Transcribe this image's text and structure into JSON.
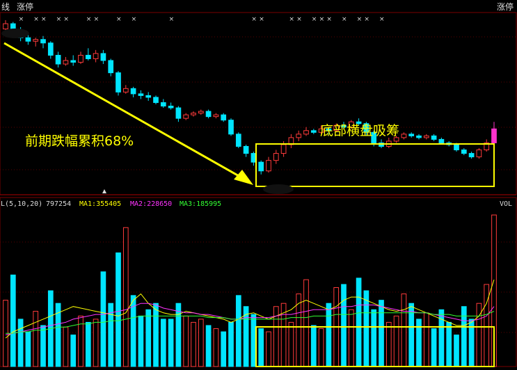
{
  "header": {
    "left_label_1": "线",
    "left_label_2": "涨停",
    "right_label": "涨停",
    "limit_marker": "×"
  },
  "colors": {
    "up": "#ff3b3b",
    "down": "#00e5ff",
    "flat": "#dddddd",
    "ma1": "#ffff00",
    "ma2": "#ff33ff",
    "ma3": "#33ff33",
    "annotation": "#ffff00",
    "grid": "#7a0000",
    "last_bar": "#ff33cc"
  },
  "annotations": {
    "decline_text": "前期跌幅累积68%",
    "bottom_text": "底部横盘吸筹"
  },
  "volume_header": {
    "prefix": "L(5,10,20)",
    "vol_value": "797254",
    "ma1_label": "MA1:355405",
    "ma2_label": "MA2:228650",
    "ma3_label": "MA3:185995",
    "vol_label": "VOL"
  },
  "chart_data": {
    "type": "candlestick",
    "price_panel": {
      "ylim": [
        0,
        100
      ]
    },
    "volume_panel": {
      "ylim": [
        0,
        100
      ]
    },
    "limit_up_bar_indices": [
      2,
      4,
      5,
      7,
      8,
      11,
      12,
      15,
      17,
      22,
      33,
      34,
      38,
      39,
      41,
      42,
      43,
      45,
      47,
      48,
      50
    ],
    "candles": [
      [
        93,
        96,
        98,
        90
      ],
      [
        96,
        91,
        97,
        88
      ],
      [
        91,
        88,
        94,
        86
      ],
      [
        88,
        86,
        90,
        84
      ],
      [
        86,
        87,
        88,
        83
      ],
      [
        87,
        85,
        89,
        82
      ],
      [
        85,
        78,
        86,
        76
      ],
      [
        78,
        73,
        80,
        71
      ],
      [
        73,
        75,
        77,
        72
      ],
      [
        75,
        74,
        78,
        72
      ],
      [
        74,
        78,
        80,
        73
      ],
      [
        78,
        76,
        82,
        75
      ],
      [
        76,
        79,
        81,
        74
      ],
      [
        79,
        75,
        81,
        73
      ],
      [
        75,
        68,
        76,
        66
      ],
      [
        68,
        57,
        69,
        55
      ],
      [
        57,
        59,
        61,
        56
      ],
      [
        59,
        56,
        60,
        54
      ],
      [
        56,
        55,
        58,
        53
      ],
      [
        55,
        54,
        57,
        52
      ],
      [
        54,
        51,
        55,
        50
      ],
      [
        51,
        49,
        53,
        48
      ],
      [
        49,
        48,
        51,
        47
      ],
      [
        48,
        42,
        49,
        40
      ],
      [
        42,
        44,
        45,
        41
      ],
      [
        44,
        45,
        46,
        43
      ],
      [
        45,
        46,
        47,
        44
      ],
      [
        46,
        43,
        47,
        42
      ],
      [
        43,
        44,
        45,
        42
      ],
      [
        44,
        41,
        45,
        40
      ],
      [
        41,
        33,
        42,
        32
      ],
      [
        33,
        26,
        34,
        25
      ],
      [
        26,
        22,
        27,
        20
      ],
      [
        22,
        17,
        23,
        15
      ],
      [
        17,
        12,
        18,
        10
      ],
      [
        12,
        18,
        20,
        11
      ],
      [
        18,
        22,
        24,
        16
      ],
      [
        22,
        27,
        29,
        20
      ],
      [
        27,
        31,
        33,
        25
      ],
      [
        31,
        33,
        35,
        29
      ],
      [
        33,
        35,
        37,
        32
      ],
      [
        35,
        34,
        36,
        33
      ],
      [
        34,
        36,
        38,
        33
      ],
      [
        36,
        35,
        37,
        33
      ],
      [
        35,
        38,
        39,
        34
      ],
      [
        38,
        37,
        40,
        36
      ],
      [
        37,
        40,
        41,
        36
      ],
      [
        40,
        39,
        42,
        38
      ],
      [
        39,
        34,
        40,
        32
      ],
      [
        34,
        28,
        35,
        26
      ],
      [
        28,
        26,
        30,
        25
      ],
      [
        26,
        29,
        31,
        25
      ],
      [
        29,
        31,
        32,
        28
      ],
      [
        31,
        33,
        34,
        30
      ],
      [
        33,
        32,
        34,
        31
      ],
      [
        32,
        31,
        33,
        30
      ],
      [
        31,
        32,
        33,
        30
      ],
      [
        32,
        30,
        33,
        29
      ],
      [
        30,
        28,
        31,
        27
      ],
      [
        28,
        27,
        29,
        26
      ],
      [
        27,
        24,
        28,
        23
      ],
      [
        24,
        22,
        25,
        21
      ],
      [
        22,
        20,
        23,
        19
      ],
      [
        20,
        24,
        25,
        19
      ],
      [
        24,
        28,
        30,
        23
      ],
      [
        28,
        36,
        40,
        27
      ]
    ],
    "volume": [
      42,
      58,
      30,
      22,
      35,
      26,
      48,
      40,
      25,
      20,
      32,
      28,
      30,
      60,
      40,
      72,
      88,
      45,
      32,
      36,
      40,
      30,
      30,
      40,
      32,
      28,
      30,
      26,
      24,
      22,
      28,
      45,
      38,
      33,
      24,
      22,
      38,
      40,
      28,
      46,
      55,
      26,
      24,
      40,
      50,
      52,
      36,
      56,
      48,
      36,
      42,
      28,
      32,
      46,
      40,
      30,
      34,
      24,
      36,
      28,
      20,
      38,
      30,
      40,
      52,
      96
    ],
    "ma1": [
      18,
      22,
      24,
      26,
      28,
      30,
      32,
      34,
      36,
      38,
      37,
      36,
      35,
      34,
      33,
      32,
      34,
      42,
      46,
      40,
      36,
      34,
      33,
      33,
      35,
      34,
      33,
      32,
      31,
      30,
      28,
      30,
      33,
      34,
      32,
      30,
      32,
      34,
      36,
      40,
      42,
      40,
      38,
      36,
      38,
      42,
      44,
      44,
      42,
      40,
      38,
      36,
      35,
      36,
      38,
      36,
      34,
      32,
      30,
      28,
      26,
      26,
      28,
      32,
      40,
      55
    ],
    "ma2": [
      20,
      21,
      22,
      23,
      24,
      25,
      26,
      27,
      28,
      30,
      31,
      32,
      33,
      33,
      34,
      35,
      36,
      38,
      40,
      40,
      39,
      37,
      36,
      35,
      34,
      34,
      33,
      33,
      32,
      31,
      30,
      30,
      31,
      31,
      31,
      31,
      32,
      33,
      33,
      34,
      35,
      36,
      36,
      36,
      37,
      38,
      38,
      39,
      39,
      39,
      38,
      37,
      36,
      35,
      35,
      34,
      34,
      33,
      32,
      31,
      30,
      29,
      29,
      30,
      32,
      38
    ],
    "ma3": [
      21,
      21,
      22,
      22,
      23,
      23,
      24,
      25,
      25,
      26,
      27,
      27,
      28,
      28,
      29,
      29,
      30,
      31,
      32,
      32,
      32,
      32,
      32,
      32,
      32,
      32,
      32,
      31,
      31,
      31,
      30,
      30,
      30,
      30,
      30,
      30,
      30,
      30,
      31,
      31,
      31,
      32,
      32,
      32,
      33,
      33,
      33,
      34,
      34,
      34,
      34,
      34,
      34,
      34,
      34,
      34,
      34,
      33,
      33,
      33,
      32,
      32,
      32,
      32,
      33,
      35
    ]
  }
}
